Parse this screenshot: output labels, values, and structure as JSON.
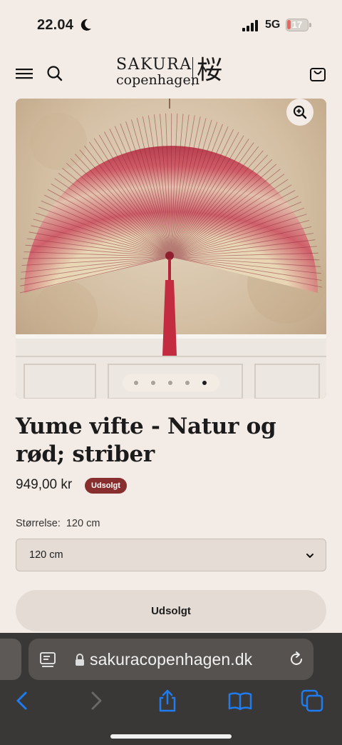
{
  "status_bar": {
    "time": "22.04",
    "network": "5G",
    "battery": "17",
    "battery_level": 0.17
  },
  "header": {
    "logo_line1": "SAKURA",
    "logo_line2": "copenhagen",
    "logo_kanji": "桜",
    "icons": [
      "menu-icon",
      "search-icon",
      "cart-icon"
    ]
  },
  "gallery": {
    "image_count": 5,
    "active_index": 4,
    "zoom_icon": "zoom-in-icon"
  },
  "product": {
    "title": "Yume vifte - Natur og rød; striber",
    "price": "949,00 kr",
    "badge": "Udsolgt",
    "size_label": "Størrelse:",
    "size_value": "120 cm",
    "size_option": "120 cm",
    "button_label": "Udsolgt"
  },
  "browser": {
    "url": "sakuracopenhagen.dk",
    "toolbar_icons": [
      "back-icon",
      "forward-icon",
      "share-icon",
      "bookmarks-icon",
      "tabs-icon"
    ]
  },
  "colors": {
    "accent_badge": "#882e2f",
    "background": "#f3ece6",
    "link_blue": "#1e7cf0"
  }
}
